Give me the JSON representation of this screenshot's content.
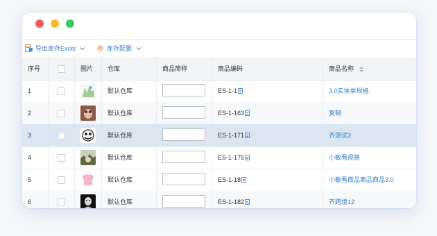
{
  "toolbar": {
    "export_label": "导出库存Excel",
    "config_label": "库存配置"
  },
  "columns": [
    "序号",
    "",
    "图片",
    "仓库",
    "商品简称",
    "商品编码",
    "商品名称"
  ],
  "rows": [
    {
      "index": "1",
      "warehouse": "默认仓库",
      "short_name": "",
      "code": "ES-1-1",
      "name": "3.0实体单规格"
    },
    {
      "index": "2",
      "warehouse": "默认仓库",
      "short_name": "",
      "code": "ES-1-163",
      "name": "复制"
    },
    {
      "index": "3",
      "warehouse": "默认仓库",
      "short_name": "",
      "code": "ES-1-171",
      "name": "齐测试3"
    },
    {
      "index": "4",
      "warehouse": "默认仓库",
      "short_name": "",
      "code": "ES-1-175",
      "name": "小敏看规格"
    },
    {
      "index": "5",
      "warehouse": "默认仓库",
      "short_name": "",
      "code": "ES-1-18",
      "name": "小敏看商品商品商品3.0"
    },
    {
      "index": "6",
      "warehouse": "默认仓库",
      "short_name": "",
      "code": "ES-1-182",
      "name": "齐跨境12"
    }
  ],
  "colors": {
    "link": "#3a7fc6",
    "selected_row": "#dbe6f2",
    "traffic_red": "#f25b55",
    "traffic_yellow": "#f7b731",
    "traffic_green": "#37c960"
  }
}
